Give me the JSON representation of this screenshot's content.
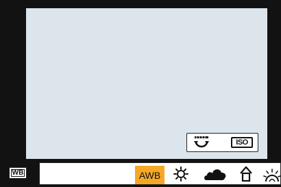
{
  "viewfinder": {
    "background": "#dde5ec"
  },
  "controls": {
    "iso_label": "ISO"
  },
  "white_balance": {
    "mode_icon_label": "WB",
    "selected": {
      "label": "AWB",
      "color": "#f5a826"
    },
    "presets": [
      "sun-icon",
      "cloud-icon",
      "house-shade-icon",
      "tungsten-icon"
    ]
  }
}
